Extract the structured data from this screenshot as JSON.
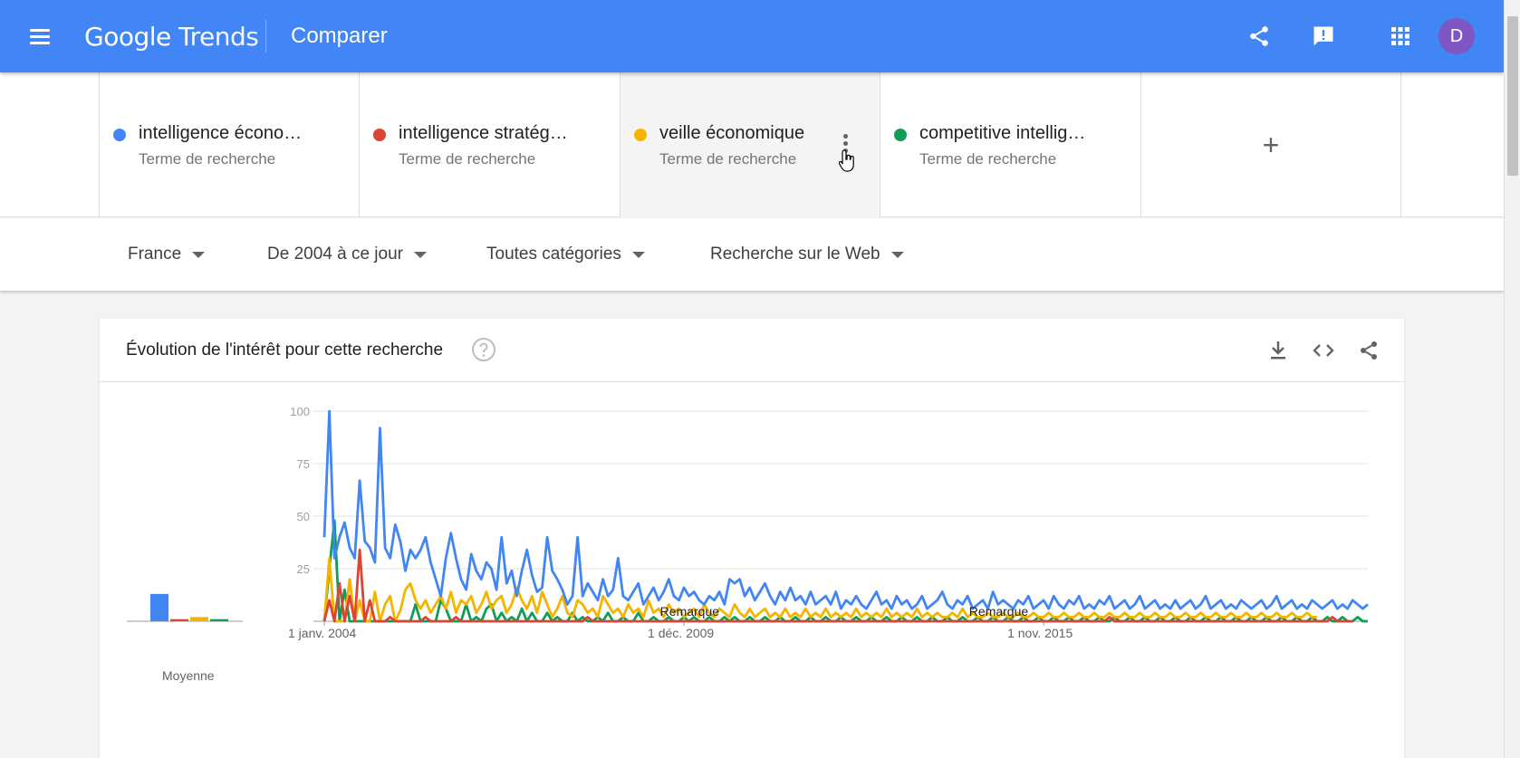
{
  "header": {
    "logo_google": "Google",
    "logo_trends": "Trends",
    "page_title": "Comparer",
    "avatar_letter": "D",
    "brand_color": "#4285f4",
    "icons": [
      "menu-icon",
      "share-icon",
      "feedback-icon",
      "apps-icon"
    ]
  },
  "terms": [
    {
      "name": "intelligence écono…",
      "type": "Terme de recherche",
      "color": "#4285f4"
    },
    {
      "name": "intelligence stratég…",
      "type": "Terme de recherche",
      "color": "#db4437"
    },
    {
      "name": "veille économique",
      "type": "Terme de recherche",
      "color": "#f4b400"
    },
    {
      "name": "competitive intellig…",
      "type": "Terme de recherche",
      "color": "#0f9d58"
    }
  ],
  "add_term_label": "+",
  "filters": {
    "region": "France",
    "period": "De 2004 à ce jour",
    "category": "Toutes catégories",
    "search_type": "Recherche sur le Web"
  },
  "card": {
    "title": "Évolution de l'intérêt pour cette recherche",
    "average_label": "Moyenne",
    "icons": [
      "help-icon",
      "download-icon",
      "embed-icon",
      "share-icon"
    ]
  },
  "chart_data": {
    "type": "line",
    "ylim": [
      0,
      100
    ],
    "yticks": [
      25,
      50,
      75,
      100
    ],
    "x_tick_labels": [
      "1 janv. 2004",
      "1 déc. 2009",
      "1 nov. 2015"
    ],
    "x_tick_index": [
      0,
      71,
      142
    ],
    "annotations": [
      {
        "label": "Remarque",
        "index": 67
      },
      {
        "label": "Remarque",
        "index": 128
      }
    ],
    "averages": [
      {
        "name": "intelligence écono…",
        "value": 13,
        "color": "#4285f4"
      },
      {
        "name": "intelligence stratég…",
        "value": 1,
        "color": "#db4437"
      },
      {
        "name": "veille économique",
        "value": 2,
        "color": "#f4b400"
      },
      {
        "name": "competitive intellig…",
        "value": 1,
        "color": "#0f9d58"
      }
    ],
    "series": [
      {
        "name": "intelligence écono…",
        "color": "#4285f4",
        "values": [
          40,
          100,
          30,
          40,
          47,
          35,
          30,
          67,
          38,
          35,
          28,
          92,
          35,
          30,
          46,
          38,
          24,
          34,
          30,
          34,
          40,
          28,
          20,
          12,
          30,
          42,
          30,
          20,
          15,
          32,
          24,
          20,
          28,
          25,
          15,
          40,
          18,
          24,
          12,
          24,
          34,
          22,
          14,
          16,
          40,
          24,
          20,
          15,
          8,
          12,
          40,
          12,
          18,
          14,
          10,
          20,
          12,
          15,
          30,
          12,
          10,
          14,
          18,
          8,
          12,
          16,
          10,
          14,
          20,
          12,
          10,
          16,
          12,
          14,
          10,
          8,
          12,
          10,
          14,
          8,
          20,
          18,
          20,
          12,
          16,
          10,
          14,
          18,
          12,
          8,
          14,
          10,
          16,
          10,
          12,
          8,
          14,
          8,
          10,
          12,
          8,
          14,
          6,
          10,
          8,
          12,
          8,
          6,
          10,
          14,
          8,
          10,
          6,
          12,
          8,
          10,
          6,
          8,
          12,
          6,
          8,
          10,
          14,
          8,
          6,
          10,
          8,
          12,
          6,
          8,
          10,
          6,
          14,
          8,
          10,
          8,
          6,
          10,
          8,
          12,
          6,
          8,
          10,
          6,
          12,
          8,
          6,
          10,
          8,
          12,
          6,
          8,
          6,
          10,
          8,
          12,
          6,
          8,
          10,
          6,
          8,
          12,
          6,
          8,
          10,
          6,
          8,
          6,
          10,
          6,
          8,
          10,
          6,
          8,
          12,
          6,
          8,
          10,
          6,
          8,
          6,
          10,
          8,
          6,
          8,
          10,
          6,
          8,
          12,
          6,
          8,
          10,
          6,
          8,
          6,
          10,
          8,
          6,
          8,
          10,
          6,
          8,
          6,
          10,
          8,
          6,
          8
        ]
      },
      {
        "name": "intelligence stratég…",
        "color": "#db4437",
        "values": [
          0,
          10,
          0,
          18,
          0,
          12,
          0,
          34,
          0,
          10,
          0,
          0,
          0,
          2,
          0,
          0,
          0,
          0,
          0,
          0,
          2,
          0,
          0,
          0,
          0,
          0,
          2,
          0,
          0,
          0,
          0,
          0,
          0,
          0,
          0,
          0,
          0,
          0,
          0,
          0,
          0,
          0,
          0,
          0,
          0,
          0,
          0,
          0,
          0,
          0,
          0,
          0,
          2,
          0,
          0,
          0,
          0,
          0,
          0,
          0,
          0,
          0,
          0,
          0,
          0,
          0,
          0,
          0,
          0,
          0,
          0,
          0,
          0,
          0,
          0,
          0,
          0,
          0,
          0,
          0,
          0,
          0,
          0,
          0,
          0,
          0,
          0,
          0,
          0,
          0,
          0,
          0,
          0,
          0,
          0,
          0,
          0,
          0,
          0,
          0,
          0,
          0,
          0,
          0,
          0,
          0,
          0,
          0,
          0,
          0,
          0,
          0,
          0,
          0,
          0,
          0,
          0,
          0,
          0,
          0,
          0,
          0,
          0,
          0,
          0,
          0,
          0,
          0,
          0,
          0,
          0,
          0,
          0,
          0,
          0,
          0,
          0,
          0,
          0,
          0,
          0,
          0,
          0,
          0,
          0,
          0,
          0,
          0,
          0,
          0,
          0,
          0,
          0,
          0,
          0,
          2,
          0,
          0,
          0,
          0,
          0,
          0,
          0,
          0,
          0,
          0,
          0,
          0,
          0,
          0,
          0,
          0,
          0,
          0,
          0,
          0,
          0,
          0,
          0,
          0,
          0,
          0,
          0,
          0,
          0,
          0,
          0,
          0,
          0,
          0,
          0,
          0,
          0,
          0,
          0,
          0,
          0,
          0,
          0,
          2,
          0,
          0,
          0,
          0
        ]
      },
      {
        "name": "veille économique",
        "color": "#f4b400",
        "values": [
          0,
          30,
          0,
          0,
          0,
          20,
          0,
          10,
          0,
          0,
          14,
          0,
          8,
          12,
          0,
          5,
          15,
          18,
          10,
          6,
          10,
          4,
          8,
          12,
          6,
          14,
          4,
          10,
          8,
          12,
          4,
          8,
          14,
          6,
          10,
          12,
          4,
          8,
          16,
          10,
          6,
          12,
          4,
          14,
          8,
          2,
          6,
          12,
          4,
          2,
          10,
          8,
          4,
          6,
          2,
          12,
          8,
          4,
          6,
          2,
          8,
          4,
          6,
          2,
          10,
          4,
          6,
          2,
          8,
          4,
          6,
          2,
          4,
          6,
          2,
          8,
          4,
          2,
          6,
          4,
          2,
          8,
          4,
          2,
          6,
          2,
          4,
          6,
          2,
          4,
          2,
          6,
          2,
          4,
          2,
          6,
          2,
          4,
          2,
          6,
          2,
          4,
          2,
          4,
          2,
          6,
          2,
          4,
          2,
          4,
          2,
          6,
          2,
          4,
          2,
          4,
          2,
          6,
          2,
          4,
          2,
          4,
          2,
          2,
          4,
          2,
          6,
          2,
          4,
          2,
          2,
          4,
          2,
          2,
          4,
          2,
          2,
          4,
          2,
          2,
          4,
          2,
          2,
          4,
          2,
          2,
          4,
          2,
          2,
          4,
          2,
          2,
          4,
          2,
          2,
          4,
          2,
          2,
          4,
          2,
          2,
          4,
          2,
          2,
          4,
          2,
          2,
          4,
          2,
          2,
          4,
          2,
          2,
          4,
          2,
          2,
          4,
          2,
          2,
          4,
          2,
          2,
          4,
          2,
          2,
          4,
          2,
          2,
          4,
          2,
          2,
          4,
          2,
          2,
          4,
          2,
          2
        ]
      },
      {
        "name": "competitive intellig…",
        "color": "#0f9d58",
        "values": [
          0,
          25,
          48,
          0,
          15,
          0,
          0,
          0,
          0,
          0,
          0,
          0,
          0,
          0,
          0,
          0,
          0,
          0,
          8,
          0,
          0,
          0,
          0,
          10,
          6,
          0,
          0,
          0,
          8,
          0,
          2,
          0,
          6,
          8,
          0,
          4,
          0,
          2,
          0,
          6,
          0,
          4,
          0,
          0,
          4,
          0,
          2,
          0,
          0,
          4,
          0,
          2,
          0,
          0,
          2,
          0,
          4,
          0,
          0,
          2,
          0,
          0,
          4,
          0,
          0,
          2,
          0,
          0,
          2,
          0,
          0,
          2,
          0,
          2,
          0,
          0,
          2,
          0,
          0,
          2,
          0,
          2,
          0,
          0,
          2,
          0,
          0,
          2,
          0,
          0,
          2,
          0,
          0,
          2,
          0,
          0,
          2,
          0,
          0,
          2,
          0,
          0,
          2,
          0,
          0,
          2,
          0,
          0,
          2,
          0,
          0,
          2,
          0,
          0,
          2,
          0,
          0,
          2,
          0,
          0,
          2,
          0,
          0,
          2,
          0,
          0,
          2,
          0,
          0,
          2,
          0,
          0,
          2,
          0,
          0,
          2,
          0,
          0,
          2,
          0,
          0,
          2,
          0,
          0,
          2,
          0,
          0,
          2,
          0,
          0,
          2,
          0,
          0,
          2,
          0,
          0,
          2,
          0,
          0,
          2,
          0,
          0,
          2,
          0,
          0,
          2,
          0,
          0,
          2,
          0,
          0,
          2,
          0,
          0,
          2,
          0,
          0,
          2,
          0,
          0,
          2,
          0,
          0,
          2,
          0,
          0,
          2,
          0,
          0,
          2,
          0,
          0,
          2,
          0,
          0,
          2,
          0,
          0,
          2,
          0,
          0,
          2,
          0,
          0,
          2,
          0,
          0
        ]
      }
    ]
  }
}
